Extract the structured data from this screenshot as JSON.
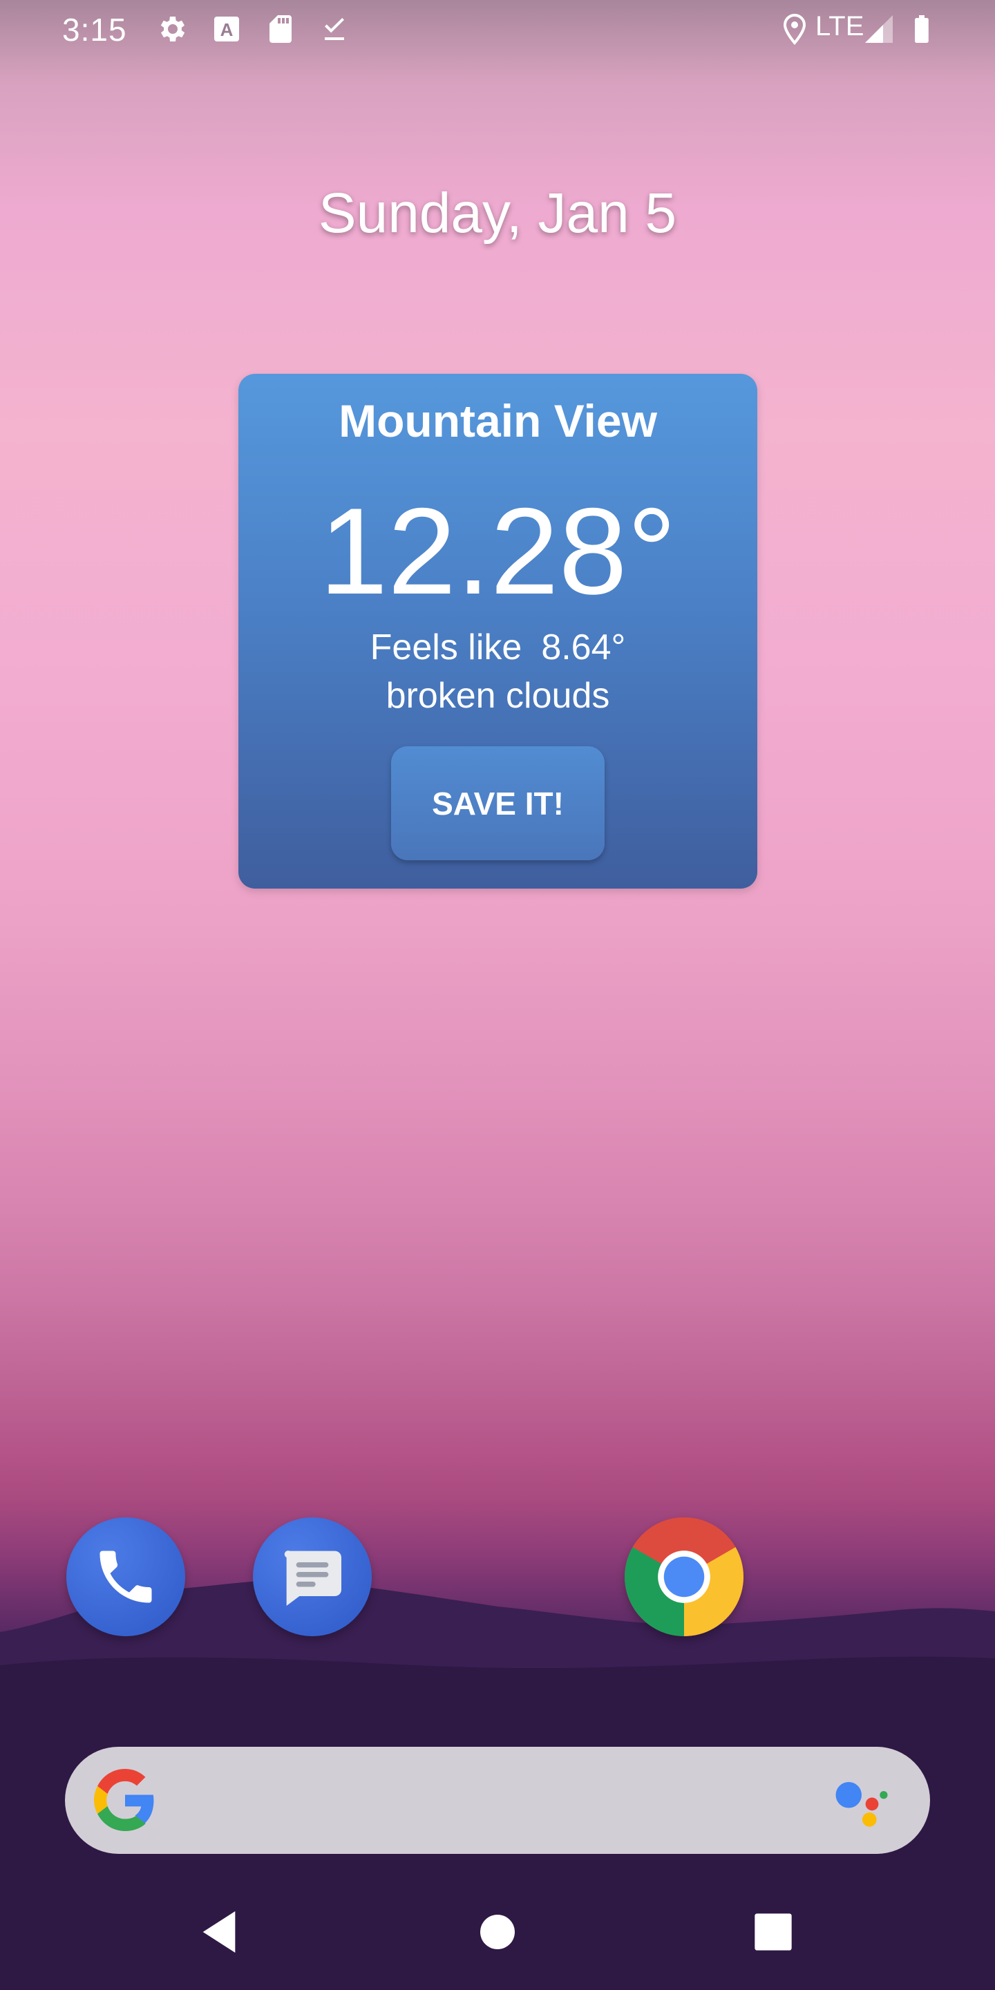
{
  "status_bar": {
    "time": "3:15",
    "network": "LTE",
    "icons": [
      "settings-icon",
      "a-notification-icon",
      "sd-card-icon",
      "download-done-icon",
      "location-icon",
      "signal-icon",
      "battery-icon"
    ]
  },
  "home": {
    "date": "Sunday, Jan 5"
  },
  "weather_widget": {
    "city": "Mountain View",
    "temperature": "12.28°",
    "feels_like_label": "Feels like",
    "feels_like_value": "8.64°",
    "condition": "broken clouds",
    "save_button": "SAVE IT!"
  },
  "dock": {
    "apps": [
      "phone-icon",
      "messages-icon",
      "chrome-icon"
    ]
  },
  "search": {
    "icons": [
      "google-g-icon",
      "google-assistant-icon"
    ]
  },
  "nav": {
    "icons": [
      "back-icon",
      "home-icon",
      "recents-icon"
    ]
  },
  "colors": {
    "widget_top": "#5698dc",
    "widget_bottom": "#3f5e9e",
    "search_bar": "#d2ced6"
  }
}
